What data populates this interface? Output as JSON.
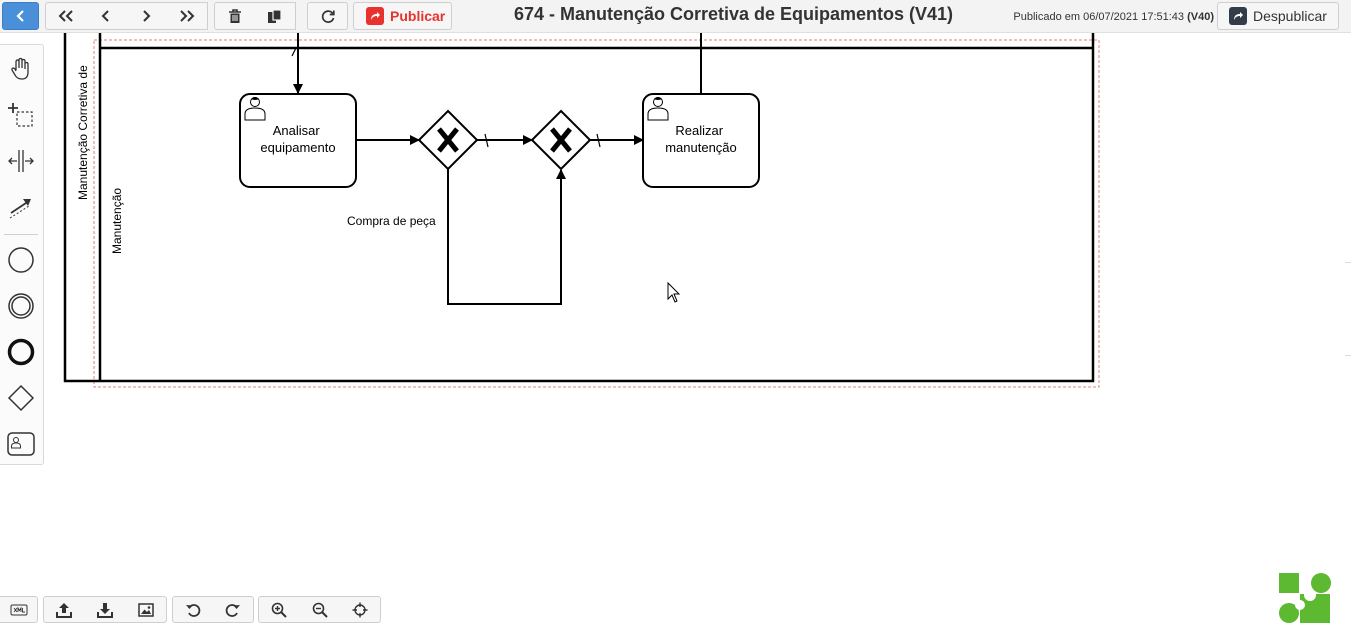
{
  "toolbar": {
    "publish_label": "Publicar",
    "title": "674 - Manutenção Corretiva de Equipamentos (V41)",
    "published_prefix": "Publicado em 06/07/2021 17:51:43 ",
    "published_version": "(V40)",
    "unpublish_label": "Despublicar"
  },
  "diagram": {
    "pool_label": "Manutenção Corretiva de",
    "lane_label": "Manutenção",
    "task_analisar": [
      "Analisar",
      "equipamento"
    ],
    "task_realizar": [
      "Realizar",
      "manutenção"
    ],
    "flow_label": "Compra de peça"
  },
  "icons": {
    "back": "chevron-left-icon",
    "first": "double-chevron-left-icon",
    "prev": "chevron-left-icon",
    "next": "chevron-right-icon",
    "last": "double-chevron-right-icon",
    "delete": "trash-icon",
    "copy": "copy-icon",
    "refresh": "refresh-icon",
    "xml": "xml-icon",
    "upload": "upload-icon",
    "download": "download-icon",
    "image": "image-icon",
    "undo": "undo-icon",
    "redo": "redo-icon",
    "zoom_in": "zoom-in-icon",
    "zoom_out": "zoom-out-icon",
    "center": "crosshair-icon"
  },
  "colors": {
    "back_button": "#4a90d9",
    "publish": "#e8322e",
    "unpublish_icon": "#333d4a",
    "logo": "#5db832",
    "selection": "#e08080"
  }
}
